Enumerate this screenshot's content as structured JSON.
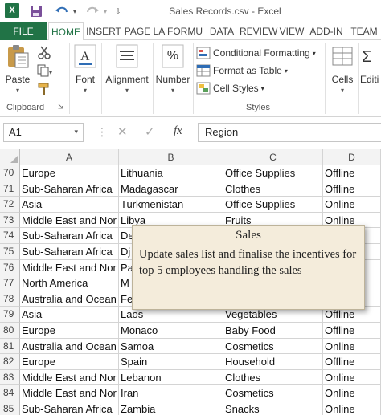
{
  "window": {
    "title": "Sales Records.csv - Excel"
  },
  "ribbon_tabs": [
    "FILE",
    "HOME",
    "INSERT",
    "PAGE LA",
    "FORMU",
    "DATA",
    "REVIEW",
    "VIEW",
    "ADD-IN",
    "TEAM"
  ],
  "ribbon": {
    "clipboard_label": "Clipboard",
    "paste_label": "Paste",
    "font_label": "Font",
    "alignment_label": "Alignment",
    "number_label": "Number",
    "percent_glyph": "%",
    "conditional_formatting": "Conditional Formatting",
    "format_as_table": "Format as Table",
    "cell_styles": "Cell Styles",
    "styles_label": "Styles",
    "cells_label": "Cells",
    "editing_label": "Editi"
  },
  "formula_bar": {
    "name_box": "A1",
    "fx_label": "fx",
    "cancel_glyph": "✕",
    "enter_glyph": "✓",
    "value": "Region"
  },
  "grid": {
    "columns": [
      "A",
      "B",
      "C",
      "D"
    ],
    "rows": [
      {
        "n": "70",
        "a": "Europe",
        "b": "Lithuania",
        "c": "Office Supplies",
        "d": "Offline"
      },
      {
        "n": "71",
        "a": "Sub-Saharan Africa",
        "b": "Madagascar",
        "c": "Clothes",
        "d": "Offline"
      },
      {
        "n": "72",
        "a": "Asia",
        "b": "Turkmenistan",
        "c": "Office Supplies",
        "d": "Online"
      },
      {
        "n": "73",
        "a": "Middle East and Nor",
        "b": "Libya",
        "c": "Fruits",
        "d": "Online"
      },
      {
        "n": "74",
        "a": "Sub-Saharan Africa",
        "b": "De",
        "c": "",
        "d": ""
      },
      {
        "n": "75",
        "a": "Sub-Saharan Africa",
        "b": "Dj",
        "c": "",
        "d": ""
      },
      {
        "n": "76",
        "a": "Middle East and Nor",
        "b": "Pa",
        "c": "",
        "d": ""
      },
      {
        "n": "77",
        "a": "North America",
        "b": "M",
        "c": "",
        "d": ""
      },
      {
        "n": "78",
        "a": "Australia and Ocean",
        "b": "Fe",
        "c": "",
        "d": ""
      },
      {
        "n": "79",
        "a": "Asia",
        "b": "Laos",
        "c": "Vegetables",
        "d": "Offline"
      },
      {
        "n": "80",
        "a": "Europe",
        "b": "Monaco",
        "c": "Baby Food",
        "d": "Offline"
      },
      {
        "n": "81",
        "a": "Australia and Ocean",
        "b": "Samoa",
        "c": "Cosmetics",
        "d": "Online"
      },
      {
        "n": "82",
        "a": "Europe",
        "b": "Spain",
        "c": "Household",
        "d": "Offline"
      },
      {
        "n": "83",
        "a": "Middle East and Nor",
        "b": "Lebanon",
        "c": "Clothes",
        "d": "Online"
      },
      {
        "n": "84",
        "a": "Middle East and Nor",
        "b": "Iran",
        "c": "Cosmetics",
        "d": "Online"
      },
      {
        "n": "85",
        "a": "Sub-Saharan Africa",
        "b": "Zambia",
        "c": "Snacks",
        "d": "Online"
      }
    ]
  },
  "comment": {
    "title": "Sales",
    "body": "Update sales list and finalise the incentives for top 5 employees handling the sales"
  },
  "colors": {
    "excel_green": "#217346",
    "comment_bg": "#f4ecdb"
  }
}
